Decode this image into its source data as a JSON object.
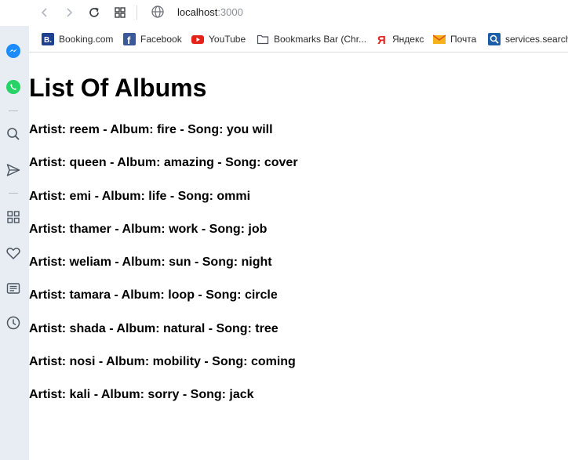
{
  "browser": {
    "address": {
      "host": "localhost",
      "port": ":3000"
    },
    "bookmarks": [
      {
        "label": "Booking.com",
        "icon": "booking-icon"
      },
      {
        "label": "Facebook",
        "icon": "facebook-icon"
      },
      {
        "label": "YouTube",
        "icon": "youtube-icon"
      },
      {
        "label": "Bookmarks Bar (Chr...",
        "icon": "folder-icon"
      },
      {
        "label": "Яндекс",
        "icon": "yandex-icon"
      },
      {
        "label": "Почта",
        "icon": "mail-icon"
      },
      {
        "label": "services.search",
        "icon": "search-service-icon"
      }
    ],
    "sidebar_icons": [
      "messenger-icon",
      "whatsapp-icon",
      "search-icon",
      "send-icon",
      "apps-icon",
      "heart-icon",
      "news-icon",
      "history-icon"
    ]
  },
  "page": {
    "title": "List Of Albums",
    "albums": [
      "Artist: reem - Album: fire - Song: you will",
      "Artist: queen - Album: amazing - Song: cover",
      "Artist: emi - Album: life - Song: ommi",
      "Artist: thamer - Album: work - Song: job",
      "Artist: weliam - Album: sun - Song: night",
      "Artist: tamara - Album: loop - Song: circle",
      "Artist: shada - Album: natural - Song: tree",
      "Artist: nosi - Album: mobility - Song: coming",
      "Artist: kali - Album: sorry - Song: jack"
    ]
  },
  "colors": {
    "sidebar_bg": "#e8edf3",
    "facebook": "#3b5998",
    "youtube": "#e62117",
    "booking": "#1f3f8f",
    "yandex": "#e0261b",
    "messenger": "#1a8cff",
    "whatsapp": "#25d366"
  }
}
